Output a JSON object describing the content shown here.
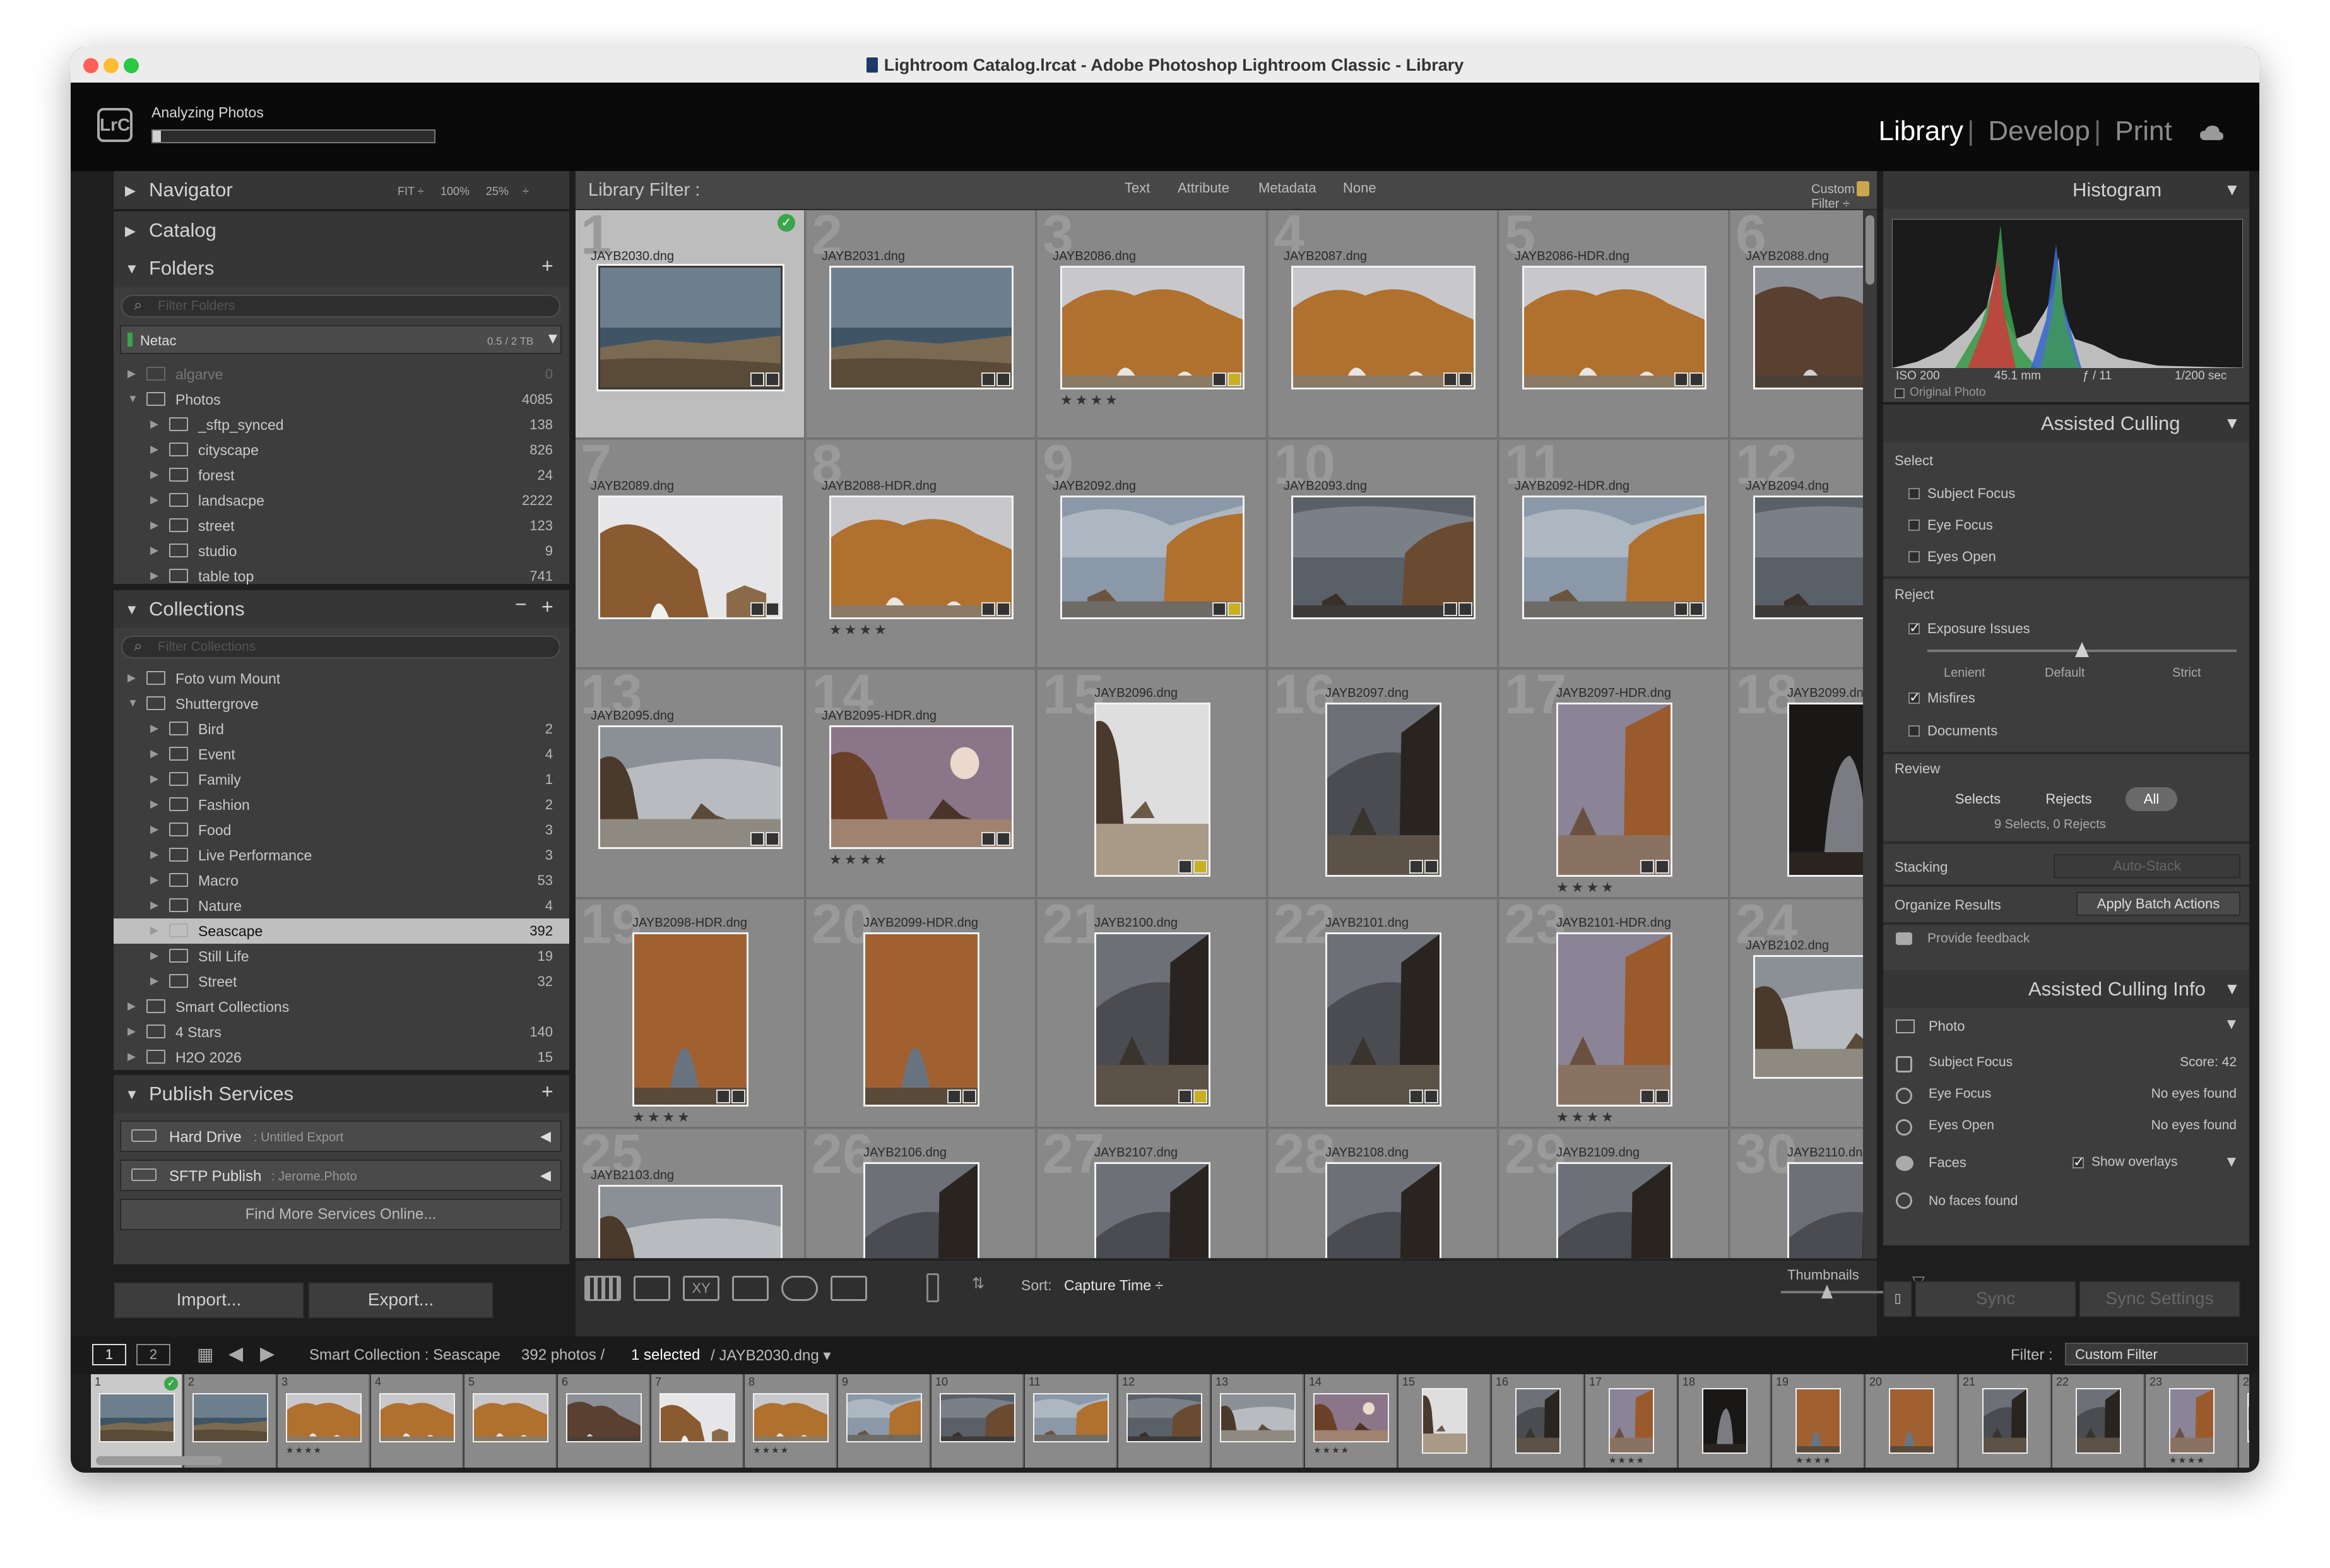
{
  "window": {
    "title": "Lightroom Catalog.lrcat - Adobe Photoshop Lightroom Classic - Library"
  },
  "identity": {
    "logo": "LrC",
    "activity": "Analyzing Photos",
    "progress_fraction": 0.03
  },
  "modules": {
    "items": [
      "Library",
      "Develop",
      "Print"
    ],
    "active": "Library",
    "cloud_icon": "cloud-sync-icon"
  },
  "navigator": {
    "title": "Navigator",
    "zoom": [
      "FIT ÷",
      "100%",
      "25%",
      "÷"
    ]
  },
  "catalog": {
    "title": "Catalog"
  },
  "folders": {
    "title": "Folders",
    "search_placeholder": "Filter Folders",
    "volume": {
      "name": "Netac",
      "usage": "0.5 / 2 TB"
    },
    "items": [
      {
        "name": "algarve",
        "count": "0",
        "level": 0,
        "dim": true
      },
      {
        "name": "Photos",
        "count": "4085",
        "level": 0,
        "open": true
      },
      {
        "name": "_sftp_synced",
        "count": "138",
        "level": 1
      },
      {
        "name": "cityscape",
        "count": "826",
        "level": 1
      },
      {
        "name": "forest",
        "count": "24",
        "level": 1
      },
      {
        "name": "landsacpe",
        "count": "2222",
        "level": 1
      },
      {
        "name": "street",
        "count": "123",
        "level": 1
      },
      {
        "name": "studio",
        "count": "9",
        "level": 1
      },
      {
        "name": "table top",
        "count": "741",
        "level": 1
      }
    ]
  },
  "collections": {
    "title": "Collections",
    "search_placeholder": "Filter Collections",
    "items": [
      {
        "name": "Foto vum Mount",
        "count": "",
        "level": 0
      },
      {
        "name": "Shuttergrove",
        "count": "",
        "level": 0,
        "open": true
      },
      {
        "name": "Bird",
        "count": "2",
        "level": 1
      },
      {
        "name": "Event",
        "count": "4",
        "level": 1
      },
      {
        "name": "Family",
        "count": "1",
        "level": 1
      },
      {
        "name": "Fashion",
        "count": "2",
        "level": 1
      },
      {
        "name": "Food",
        "count": "3",
        "level": 1
      },
      {
        "name": "Live Performance",
        "count": "3",
        "level": 1
      },
      {
        "name": "Macro",
        "count": "53",
        "level": 1
      },
      {
        "name": "Nature",
        "count": "4",
        "level": 1
      },
      {
        "name": "Seascape",
        "count": "392",
        "level": 1,
        "selected": true
      },
      {
        "name": "Still Life",
        "count": "19",
        "level": 1
      },
      {
        "name": "Street",
        "count": "32",
        "level": 1
      },
      {
        "name": "Smart Collections",
        "count": "",
        "level": 0
      },
      {
        "name": "4 Stars",
        "count": "140",
        "level": 0
      },
      {
        "name": "H2O 2026",
        "count": "15",
        "level": 0
      }
    ]
  },
  "publish": {
    "title": "Publish Services",
    "services": [
      {
        "name": "Hard Drive",
        "sub": ": Untitled Export"
      },
      {
        "name": "SFTP Publish",
        "sub": ": Jerome.Photo"
      }
    ],
    "find_more": "Find More Services Online..."
  },
  "left_buttons": {
    "import": "Import...",
    "export": "Export..."
  },
  "filter": {
    "label": "Library Filter :",
    "options": [
      "Text",
      "Attribute",
      "Metadata",
      "None"
    ],
    "custom": "Custom Filter ÷"
  },
  "grid": {
    "cells": [
      {
        "n": "1",
        "file": "JAYB2030.dng",
        "scene": "sea",
        "selected": true,
        "check": true
      },
      {
        "n": "2",
        "file": "JAYB2031.dng",
        "scene": "sea"
      },
      {
        "n": "3",
        "file": "JAYB2086.dng",
        "scene": "arch",
        "stars": "★★★★"
      },
      {
        "n": "4",
        "file": "JAYB2087.dng",
        "scene": "arch"
      },
      {
        "n": "5",
        "file": "JAYB2086-HDR.dng",
        "scene": "arch"
      },
      {
        "n": "6",
        "file": "JAYB2088.dng",
        "scene": "archdark"
      },
      {
        "n": "7",
        "file": "JAYB2089.dng",
        "scene": "archlight"
      },
      {
        "n": "8",
        "file": "JAYB2088-HDR.dng",
        "scene": "arch",
        "stars": "★★★★"
      },
      {
        "n": "9",
        "file": "JAYB2092.dng",
        "scene": "cliffsky"
      },
      {
        "n": "10",
        "file": "JAYB2093.dng",
        "scene": "cliffdark"
      },
      {
        "n": "11",
        "file": "JAYB2092-HDR.dng",
        "scene": "cliffsky"
      },
      {
        "n": "12",
        "file": "JAYB2094.dng",
        "scene": "cliffdark"
      },
      {
        "n": "13",
        "file": "JAYB2095.dng",
        "scene": "beach"
      },
      {
        "n": "14",
        "file": "JAYB2095-HDR.dng",
        "scene": "sunset",
        "stars": "★★★★"
      },
      {
        "n": "15",
        "file": "JAYB2096.dng",
        "scene": "portbeach",
        "portrait": true
      },
      {
        "n": "16",
        "file": "JAYB2097.dng",
        "scene": "portdark",
        "portrait": true
      },
      {
        "n": "17",
        "file": "JAYB2097-HDR.dng",
        "scene": "portwarm",
        "portrait": true,
        "stars": "★★★★"
      },
      {
        "n": "18",
        "file": "JAYB2099.dng",
        "scene": "cave",
        "portrait": true
      },
      {
        "n": "19",
        "file": "JAYB2098-HDR.dng",
        "scene": "portarch",
        "portrait": true,
        "stars": "★★★★"
      },
      {
        "n": "20",
        "file": "JAYB2099-HDR.dng",
        "scene": "portarch",
        "portrait": true
      },
      {
        "n": "21",
        "file": "JAYB2100.dng",
        "scene": "portdark",
        "portrait": true
      },
      {
        "n": "22",
        "file": "JAYB2101.dng",
        "scene": "portdark",
        "portrait": true
      },
      {
        "n": "23",
        "file": "JAYB2101-HDR.dng",
        "scene": "portwarm",
        "portrait": true,
        "stars": "★★★★"
      },
      {
        "n": "24",
        "file": "JAYB2102.dng",
        "scene": "beach"
      },
      {
        "n": "25",
        "file": "JAYB2103.dng",
        "scene": "beach"
      },
      {
        "n": "26",
        "file": "JAYB2106.dng",
        "scene": "portdark",
        "portrait": true
      },
      {
        "n": "27",
        "file": "JAYB2107.dng",
        "scene": "portdark",
        "portrait": true
      },
      {
        "n": "28",
        "file": "JAYB2108.dng",
        "scene": "portdark",
        "portrait": true
      },
      {
        "n": "29",
        "file": "JAYB2109.dng",
        "scene": "portdark",
        "portrait": true
      },
      {
        "n": "30",
        "file": "JAYB2110.dng",
        "scene": "portdark",
        "portrait": true
      }
    ]
  },
  "toolbar": {
    "sort_label": "Sort:",
    "sort_value": "Capture Time ÷",
    "thumbnails_label": "Thumbnails"
  },
  "histogram": {
    "title": "Histogram",
    "iso": "ISO 200",
    "focal": "45.1 mm",
    "aperture": "ƒ / 11",
    "shutter": "1/200 sec",
    "original": "Original Photo"
  },
  "culling": {
    "title": "Assisted Culling",
    "select_label": "Select",
    "select_items": [
      {
        "label": "Subject Focus",
        "on": false
      },
      {
        "label": "Eye Focus",
        "on": false
      },
      {
        "label": "Eyes Open",
        "on": false
      }
    ],
    "reject_label": "Reject",
    "exposure": {
      "label": "Exposure Issues",
      "on": true
    },
    "slider_labels": [
      "Lenient",
      "Default",
      "Strict"
    ],
    "slider_value": 0.5,
    "reject_items": [
      {
        "label": "Misfires",
        "on": true
      },
      {
        "label": "Documents",
        "on": false
      }
    ],
    "review_label": "Review",
    "review_options": [
      "Selects",
      "Rejects",
      "All"
    ],
    "review_active": "All",
    "review_summary": "9 Selects, 0 Rejects",
    "stacking_label": "Stacking",
    "stacking_button": "Auto-Stack",
    "organize_label": "Organize Results",
    "organize_button": "Apply Batch Actions",
    "feedback": "Provide feedback"
  },
  "culling_info": {
    "title": "Assisted Culling Info",
    "photo_label": "Photo",
    "rows": [
      {
        "label": "Subject Focus",
        "value": "Score: 42",
        "icon": "subject-focus-icon"
      },
      {
        "label": "Eye Focus",
        "value": "No eyes found",
        "icon": "no-eye-icon"
      },
      {
        "label": "Eyes Open",
        "value": "No eyes found",
        "icon": "no-eye-icon"
      }
    ],
    "faces_label": "Faces",
    "show_overlays": "Show overlays",
    "no_faces": "No faces found"
  },
  "sync": {
    "sync": "Sync",
    "sync_settings": "Sync Settings"
  },
  "filmstrip": {
    "pages": [
      "1",
      "2"
    ],
    "source": "Smart Collection : Seascape",
    "count_prefix": "392 photos /",
    "selected": "1 selected",
    "current": "/ JAYB2030.dng ▾",
    "filter_label": "Filter :",
    "filter_value": "Custom Filter"
  },
  "colors": {
    "accent": "#3aa54a",
    "panel": "#3d3d3d",
    "grid_cell": "#888888",
    "selected_cell": "#bdbdbd"
  }
}
